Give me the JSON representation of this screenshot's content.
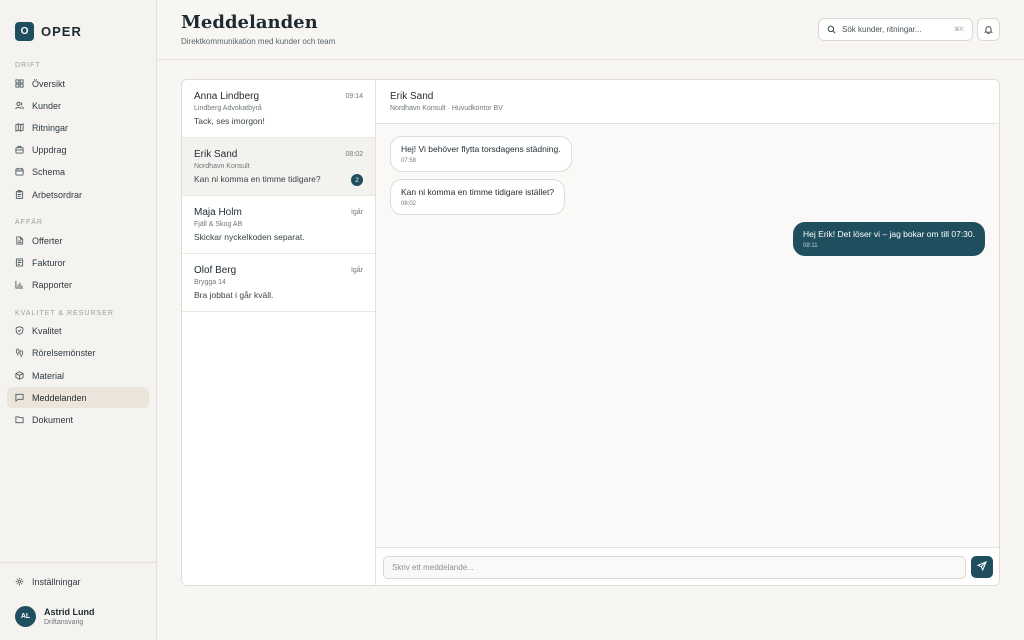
{
  "brand": {
    "logo_letter": "O",
    "name": "OPER"
  },
  "sidebar": {
    "sections": [
      {
        "label": "DRIFT"
      },
      {
        "label": "AFFÄR"
      },
      {
        "label": "KVALITET & RESURSER"
      }
    ],
    "items": [
      {
        "label": "Översikt",
        "icon": "grid-icon"
      },
      {
        "label": "Kunder",
        "icon": "users-icon"
      },
      {
        "label": "Ritningar",
        "icon": "map-icon"
      },
      {
        "label": "Uppdrag",
        "icon": "briefcase-icon"
      },
      {
        "label": "Schema",
        "icon": "calendar-icon"
      },
      {
        "label": "Arbetsordrar",
        "icon": "clipboard-icon"
      },
      {
        "label": "Offerter",
        "icon": "document-icon"
      },
      {
        "label": "Fakturor",
        "icon": "receipt-icon"
      },
      {
        "label": "Rapporter",
        "icon": "bar-chart-icon"
      },
      {
        "label": "Kvalitet",
        "icon": "shield-icon"
      },
      {
        "label": "Rörelsemönster",
        "icon": "footprints-icon"
      },
      {
        "label": "Material",
        "icon": "box-icon"
      },
      {
        "label": "Meddelanden",
        "icon": "message-icon",
        "active": true
      },
      {
        "label": "Dokument",
        "icon": "folder-icon"
      }
    ],
    "settings_label": "Inställningar",
    "user": {
      "initials": "AL",
      "name": "Astrid Lund",
      "role": "Driftansvarig"
    }
  },
  "header": {
    "title": "Meddelanden",
    "subtitle": "Direktkommunikation med kunder och team",
    "search_placeholder": "Sök kunder, ritningar...",
    "search_shortcut": "⌘K"
  },
  "conversations": [
    {
      "name": "Anna Lindberg",
      "company": "Lindberg Advokatbyrå",
      "preview": "Tack, ses imorgon!",
      "time": "09:14"
    },
    {
      "name": "Erik Sand",
      "company": "Nordhavn Konsult",
      "preview": "Kan ni komma en timme tidigare?",
      "time": "08:02",
      "unread": "2",
      "active": true
    },
    {
      "name": "Maja Holm",
      "company": "Fjäll & Skog AB",
      "preview": "Skickar nyckelkoden separat.",
      "time": "Igår"
    },
    {
      "name": "Olof Berg",
      "company": "Brygga 14",
      "preview": "Bra jobbat i går kväll.",
      "time": "Igår"
    }
  ],
  "chat": {
    "name": "Erik Sand",
    "subtitle": "Nordhavn Konsult · Huvudkontor BV",
    "messages": [
      {
        "direction": "in",
        "text": "Hej! Vi behöver flytta torsdagens städning.",
        "time": "07:58"
      },
      {
        "direction": "in",
        "text": "Kan ni komma en timme tidigare istället?",
        "time": "08:02"
      },
      {
        "direction": "out",
        "text": "Hej Erik! Det löser vi – jag bokar om till 07:30.",
        "time": "08:11"
      }
    ],
    "composer_placeholder": "Skriv ett meddelande..."
  },
  "colors": {
    "accent": "#1f4e5f",
    "active_nav": "#ebe5dc",
    "background": "#f7f6f3"
  }
}
